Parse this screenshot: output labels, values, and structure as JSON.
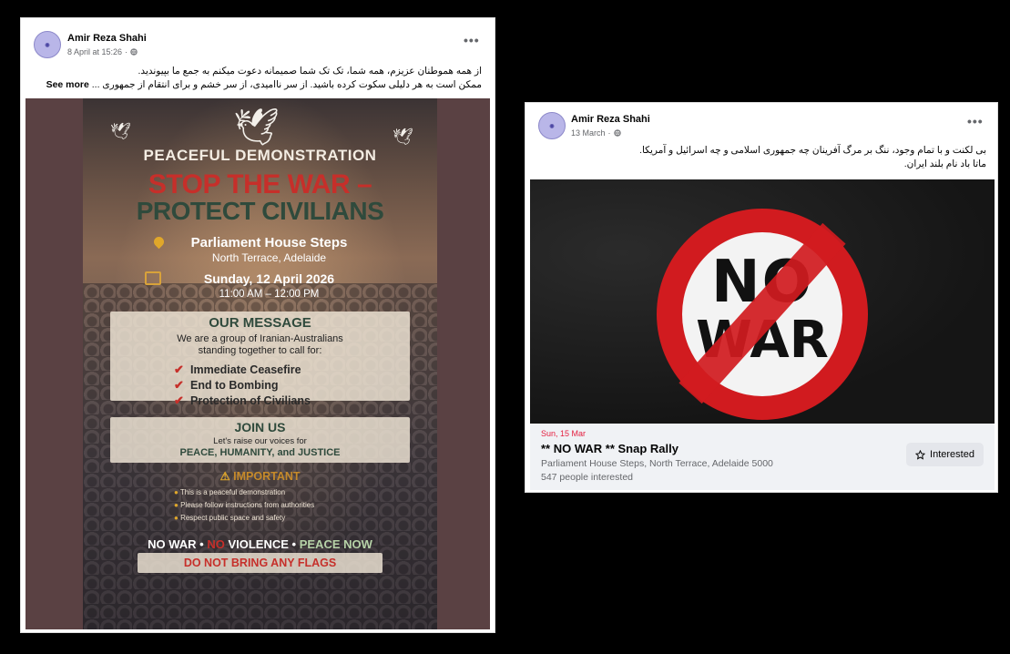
{
  "post1": {
    "author": "Amir Reza Shahi",
    "timestamp": "8 April at 15:26",
    "text_line1": "از همه هموطنان عزیزم، همه شما، تک تک شما صمیمانه دعوت میکنم به جمع ما بپیوندید.",
    "text_line2": "ممکن است به هر دلیلی سکوت کرده باشید. از سر ناامیدی، از سر خشم و برای انتقام از جمهوری ...",
    "see_more": "See more",
    "poster": {
      "subtitle": "PEACEFUL DEMONSTRATION",
      "headline1": "STOP THE WAR –",
      "headline2": "PROTECT CIVILIANS",
      "location": "Parliament House Steps",
      "location_sub": "North Terrace, Adelaide",
      "date": "Sunday, 12 April 2026",
      "time": "11:00 AM – 12:00 PM",
      "message_heading": "OUR MESSAGE",
      "message_line1": "We are a group of Iranian-Australians",
      "message_line2": "standing together to call for:",
      "demands": [
        "Immediate Ceasefire",
        "End to Bombing",
        "Protection of Civilians"
      ],
      "join_heading": "JOIN US",
      "join_line1": "Let's raise our voices for",
      "join_line2": "PEACE, HUMANITY, and JUSTICE",
      "important_heading": "IMPORTANT",
      "important_items": [
        "This is a peaceful demonstration",
        "Please follow instructions from authorities",
        "Respect public space and safety"
      ],
      "slogan_a": "NO WAR",
      "slogan_b": "NO",
      "slogan_c": "VIOLENCE",
      "slogan_d": "PEACE NOW",
      "flags": "DO NOT BRING ANY FLAGS"
    }
  },
  "post2": {
    "author": "Amir Reza Shahi",
    "timestamp": "13 March",
    "text_line1": "بی لکنت و با تمام وجود، ننگ بر مرگ آفرینان چه جمهوری  اسلامی و چه اسرائیل و آمریکا.",
    "text_line2": "ماتا باد نام بلند ایران.",
    "image": {
      "word1": "NO",
      "word2": "WAR"
    },
    "event": {
      "date": "Sun, 15 Mar",
      "title": "** NO WAR ** Snap Rally",
      "location": "Parliament House Steps, North Terrace, Adelaide 5000",
      "interested_count": "547 people interested",
      "button_label": "Interested"
    }
  },
  "colors": {
    "accent_red": "#c62f2a",
    "event_date": "#e41e3f",
    "sign_red": "#d11b1f"
  }
}
